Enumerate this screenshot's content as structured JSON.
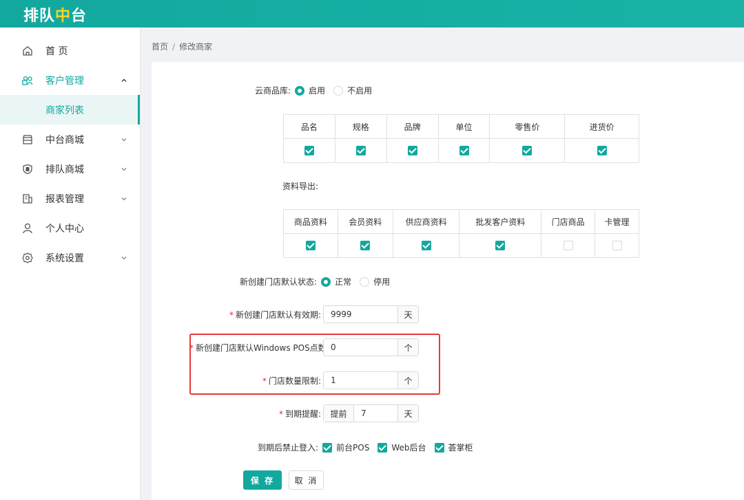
{
  "app": {
    "logo_part1": "排队",
    "logo_part2": "中",
    "logo_part3": "台"
  },
  "sidebar": {
    "items": [
      {
        "label": "首 页",
        "icon": "home-icon"
      },
      {
        "label": "客户管理",
        "icon": "customers-icon"
      },
      {
        "label": "中台商城",
        "icon": "store-icon"
      },
      {
        "label": "排队商城",
        "icon": "shield-icon"
      },
      {
        "label": "报表管理",
        "icon": "report-icon"
      },
      {
        "label": "个人中心",
        "icon": "user-icon"
      },
      {
        "label": "系统设置",
        "icon": "gear-icon"
      }
    ],
    "sub_item": "商家列表"
  },
  "breadcrumb": {
    "home": "首页",
    "sep": "/",
    "current": "修改商家"
  },
  "form": {
    "cloud_library": {
      "label": "云商品库:",
      "opt_on": "启用",
      "opt_off": "不启用",
      "selected": "启用"
    },
    "cloud_table": {
      "headers": [
        "品名",
        "规格",
        "品牌",
        "单位",
        "零售价",
        "进货价"
      ],
      "checked": [
        true,
        true,
        true,
        true,
        true,
        true
      ]
    },
    "export": {
      "label": "资料导出:"
    },
    "export_table": {
      "headers": [
        "商品资料",
        "会员资料",
        "供应商资料",
        "批发客户资料",
        "门店商品",
        "卡管理"
      ],
      "checked": [
        true,
        true,
        true,
        true,
        false,
        false
      ]
    },
    "default_status": {
      "label": "新创建门店默认状态:",
      "opt_on": "正常",
      "opt_off": "停用",
      "selected": "正常"
    },
    "validity": {
      "label": "新创建门店默认有效期:",
      "value": "9999",
      "unit": "天"
    },
    "pos_count": {
      "label": "新创建门店默认Windows POS点数:",
      "value": "0",
      "unit": "个"
    },
    "store_limit": {
      "label": "门店数量限制:",
      "value": "1",
      "unit": "个"
    },
    "expire_remind": {
      "label": "到期提醒:",
      "prefix": "提前",
      "value": "7",
      "unit": "天"
    },
    "expire_block": {
      "label": "到期后禁止登入:",
      "options": [
        "前台POS",
        "Web后台",
        "荟掌柜"
      ],
      "checked": [
        true,
        true,
        true
      ]
    },
    "save_label": "保 存",
    "cancel_label": "取 消"
  },
  "colors": {
    "brand": "#13a89e",
    "highlight": "#e53935",
    "required": "#f5222d"
  }
}
